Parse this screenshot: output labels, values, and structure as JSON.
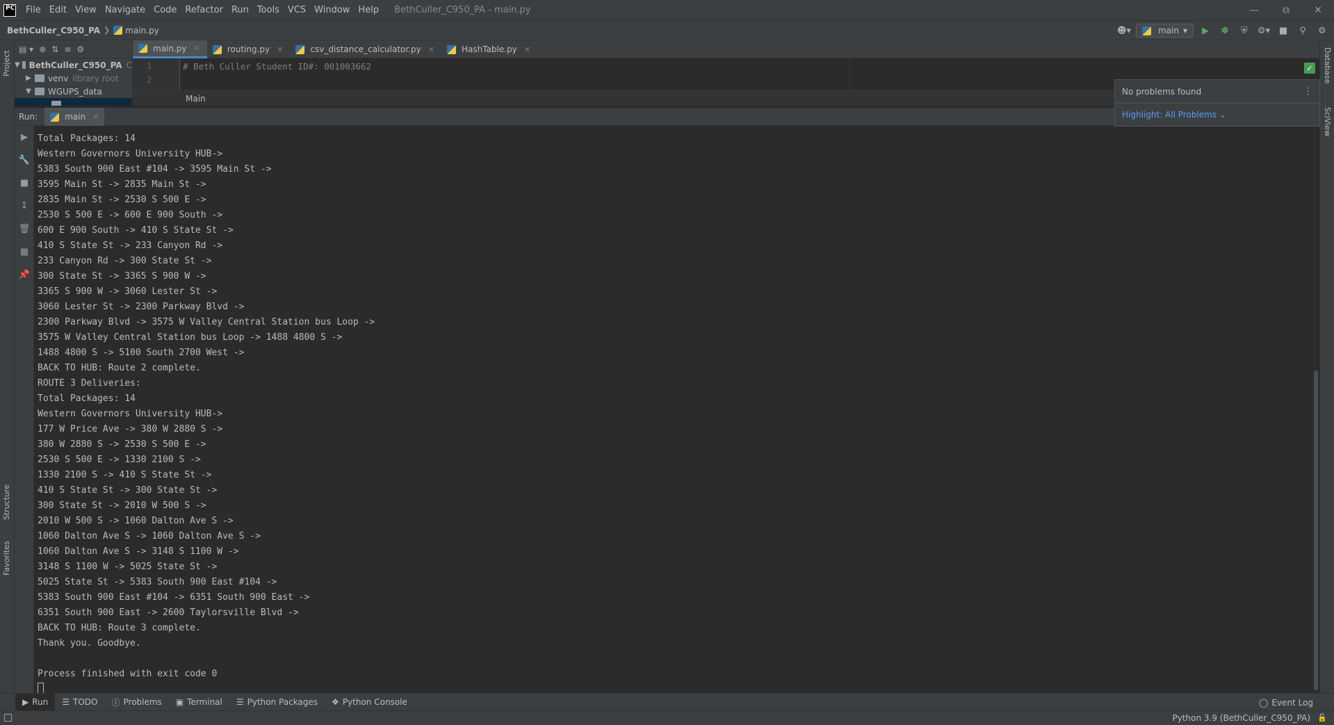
{
  "menu": {
    "logo": "PC",
    "items": [
      "File",
      "Edit",
      "View",
      "Navigate",
      "Code",
      "Refactor",
      "Run",
      "Tools",
      "VCS",
      "Window",
      "Help"
    ],
    "window_title": "BethCuller_C950_PA - main.py"
  },
  "navbar": {
    "project": "BethCuller_C950_PA",
    "file": "main.py",
    "run_config": "main"
  },
  "project_panel": {
    "label": "Project",
    "tree": [
      {
        "name": "BethCuller_C950_PA",
        "extra": "C"
      },
      {
        "name": "venv",
        "extra": "library root"
      },
      {
        "name": "WGUPS_data",
        "extra": ""
      }
    ]
  },
  "editor": {
    "tabs": [
      "main.py",
      "routing.py",
      "csv_distance_calculator.py",
      "HashTable.py"
    ],
    "lines": [
      {
        "no": "1",
        "text": "# Beth Culler Student ID#: 001003662"
      },
      {
        "no": "2",
        "text": ""
      }
    ],
    "breadcrumb": "Main"
  },
  "problems_popup": {
    "status": "No problems found",
    "highlight": "Highlight: All Problems"
  },
  "run_window": {
    "label": "Run:",
    "tab": "main",
    "output": [
      "Total Packages: 14",
      "Western Governors University HUB->",
      "5383 South 900 East #104 -> 3595 Main St ->",
      "3595 Main St -> 2835 Main St ->",
      "2835 Main St -> 2530 S 500 E ->",
      "2530 S 500 E -> 600 E 900 South ->",
      "600 E 900 South -> 410 S State St ->",
      "410 S State St -> 233 Canyon Rd ->",
      "233 Canyon Rd -> 300 State St ->",
      "300 State St -> 3365 S 900 W ->",
      "3365 S 900 W -> 3060 Lester St ->",
      "3060 Lester St -> 2300 Parkway Blvd ->",
      "2300 Parkway Blvd -> 3575 W Valley Central Station bus Loop ->",
      "3575 W Valley Central Station bus Loop -> 1488 4800 S ->",
      "1488 4800 S -> 5100 South 2700 West ->",
      "BACK TO HUB: Route 2 complete.",
      "ROUTE 3 Deliveries:",
      "Total Packages: 14",
      "Western Governors University HUB->",
      "177 W Price Ave -> 380 W 2880 S ->",
      "380 W 2880 S -> 2530 S 500 E ->",
      "2530 S 500 E -> 1330 2100 S ->",
      "1330 2100 S -> 410 S State St ->",
      "410 S State St -> 300 State St ->",
      "300 State St -> 2010 W 500 S ->",
      "2010 W 500 S -> 1060 Dalton Ave S ->",
      "1060 Dalton Ave S -> 1060 Dalton Ave S ->",
      "1060 Dalton Ave S -> 3148 S 1100 W ->",
      "3148 S 1100 W -> 5025 State St ->",
      "5025 State St -> 5383 South 900 East #104 ->",
      "5383 South 900 East #104 -> 6351 South 900 East ->",
      "6351 South 900 East -> 2600 Taylorsville Blvd ->",
      "BACK TO HUB: Route 3 complete.",
      "Thank you. Goodbye.",
      "",
      "Process finished with exit code 0"
    ]
  },
  "side_labels": {
    "structure": "Structure",
    "favorites": "Favorites",
    "database": "Database",
    "sciview": "SciView"
  },
  "bottom_tools": [
    "Run",
    "TODO",
    "Problems",
    "Terminal",
    "Python Packages",
    "Python Console"
  ],
  "event_log": "Event Log",
  "status": {
    "interpreter": "Python 3.9 (BethCuller_C950_PA)"
  },
  "colors": {
    "accent": "#4a88c7",
    "run_green": "#59a869",
    "link": "#589df6"
  }
}
